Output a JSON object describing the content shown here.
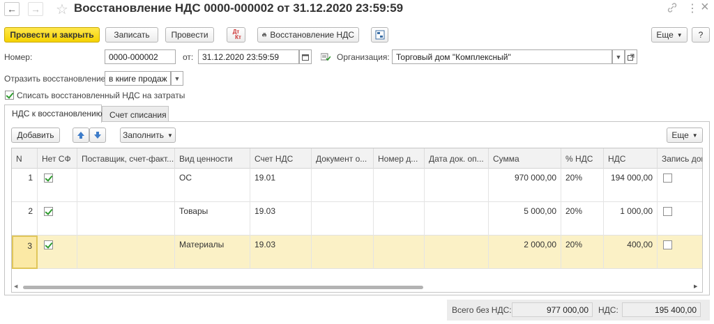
{
  "header": {
    "title": "Восстановление НДС 0000-000002 от 31.12.2020 23:59:59",
    "back_glyph": "←",
    "forward_glyph": "→",
    "star_glyph": "☆",
    "link_glyph": "🔗",
    "more_glyph": "⋮",
    "close_glyph": "×"
  },
  "toolbar": {
    "post_close": "Провести и закрыть",
    "save": "Записать",
    "post": "Провести",
    "dt_kt_top": "Дт",
    "dt_kt_bottom": "Кт",
    "restore_vat": "Восстановление НДС",
    "more": "Еще",
    "help": "?"
  },
  "form": {
    "number_label": "Номер:",
    "number_value": "0000-000002",
    "date_label": "от:",
    "date_value": "31.12.2020 23:59:59",
    "org_label": "Организация:",
    "org_value": "Торговый дом \"Комплексный\"",
    "reflect_label": "Отразить восстановление:",
    "reflect_value": "в книге продаж",
    "writeoff_label": "Списать восстановленный НДС на затраты",
    "writeoff_checked": true
  },
  "tabs": [
    {
      "label": "НДС к восстановлению",
      "active": true
    },
    {
      "label": "Счет списания",
      "active": false
    }
  ],
  "table_toolbar": {
    "add": "Добавить",
    "fill": "Заполнить",
    "more": "Еще"
  },
  "table": {
    "columns": [
      "N",
      "Нет СФ",
      "Поставщик, счет-факт...",
      "Вид ценности",
      "Счет НДС",
      "Документ о...",
      "Номер д...",
      "Дата док. оп...",
      "Сумма",
      "% НДС",
      "НДС",
      "Запись доп"
    ],
    "rows": [
      {
        "n": "1",
        "no_invoice": true,
        "supplier": "",
        "kind": "ОС",
        "account": "19.01",
        "doc": "",
        "doc_no": "",
        "doc_date": "",
        "sum": "970 000,00",
        "rate": "20%",
        "vat": "194 000,00",
        "extra": false,
        "selected": false
      },
      {
        "n": "2",
        "no_invoice": true,
        "supplier": "",
        "kind": "Товары",
        "account": "19.03",
        "doc": "",
        "doc_no": "",
        "doc_date": "",
        "sum": "5 000,00",
        "rate": "20%",
        "vat": "1 000,00",
        "extra": false,
        "selected": false
      },
      {
        "n": "3",
        "no_invoice": true,
        "supplier": "",
        "kind": "Материалы",
        "account": "19.03",
        "doc": "",
        "doc_no": "",
        "doc_date": "",
        "sum": "2 000,00",
        "rate": "20%",
        "vat": "400,00",
        "extra": false,
        "selected": true
      }
    ]
  },
  "totals": {
    "total_label": "Всего без НДС:",
    "total_value": "977 000,00",
    "vat_label": "НДС:",
    "vat_value": "195 400,00"
  }
}
